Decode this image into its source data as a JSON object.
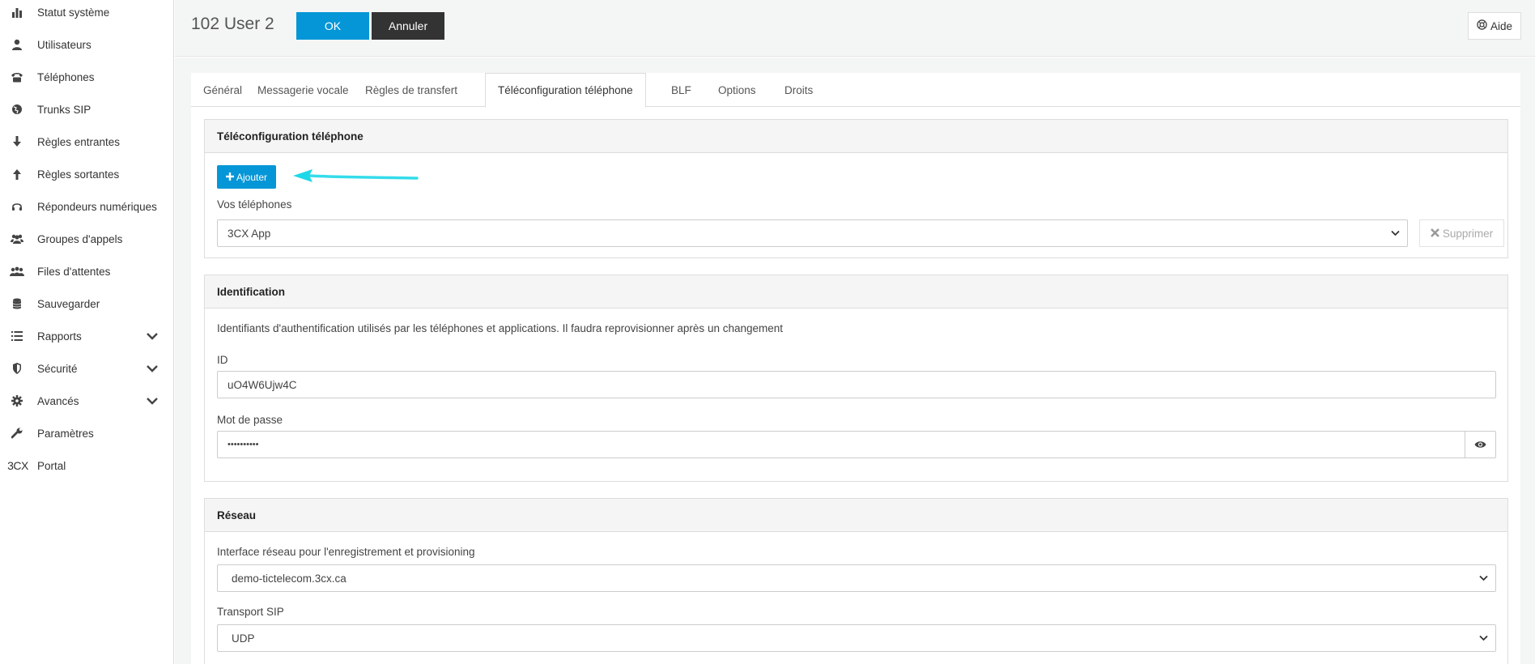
{
  "sidebar": {
    "items": [
      {
        "label": "Statut système",
        "icon": "bar-chart-icon"
      },
      {
        "label": "Utilisateurs",
        "icon": "user-icon"
      },
      {
        "label": "Téléphones",
        "icon": "phone-icon"
      },
      {
        "label": "Trunks SIP",
        "icon": "globe-icon"
      },
      {
        "label": "Règles entrantes",
        "icon": "arrow-down-icon"
      },
      {
        "label": "Règles sortantes",
        "icon": "arrow-up-icon"
      },
      {
        "label": "Répondeurs numériques",
        "icon": "headset-icon"
      },
      {
        "label": "Groupes d'appels",
        "icon": "group-icon"
      },
      {
        "label": "Files d'attentes",
        "icon": "queue-icon"
      },
      {
        "label": "Sauvegarder",
        "icon": "database-icon"
      },
      {
        "label": "Rapports",
        "icon": "list-icon"
      },
      {
        "label": "Sécurité",
        "icon": "shield-icon"
      },
      {
        "label": "Avancés",
        "icon": "gear-icon"
      },
      {
        "label": "Paramètres",
        "icon": "wrench-icon"
      },
      {
        "label": "Portal",
        "icon": "3cx-logo",
        "logo_text": "3CX"
      }
    ]
  },
  "header": {
    "title": "102 User 2",
    "ok_label": "OK",
    "cancel_label": "Annuler",
    "help_label": "Aide"
  },
  "tabs": [
    {
      "label": "Général"
    },
    {
      "label": "Messagerie vocale"
    },
    {
      "label": "Règles de transfert"
    },
    {
      "label": "Téléconfiguration téléphone",
      "active": true
    },
    {
      "label": "BLF"
    },
    {
      "label": "Options"
    },
    {
      "label": "Droits"
    }
  ],
  "provisioning": {
    "title": "Téléconfiguration téléphone",
    "add_label": "Ajouter",
    "phones_label": "Vos téléphones",
    "phones_value": "3CX App",
    "delete_label": "Supprimer"
  },
  "identification": {
    "title": "Identification",
    "description": "Identifiants d'authentification utilisés par les téléphones et applications. Il faudra reprovisionner après un changement",
    "id_label": "ID",
    "id_value": "uO4W6Ujw4C",
    "password_label": "Mot de passe",
    "password_value": "••••••••••"
  },
  "network": {
    "title": "Réseau",
    "interface_label": "Interface réseau pour l'enregistrement et provisioning",
    "interface_value": "demo-tictelecom.3cx.ca",
    "transport_label": "Transport SIP",
    "transport_value": "UDP"
  },
  "colors": {
    "primary": "#0596d7",
    "dark_button": "#333333",
    "annotation_arrow": "#1ed8e8"
  }
}
